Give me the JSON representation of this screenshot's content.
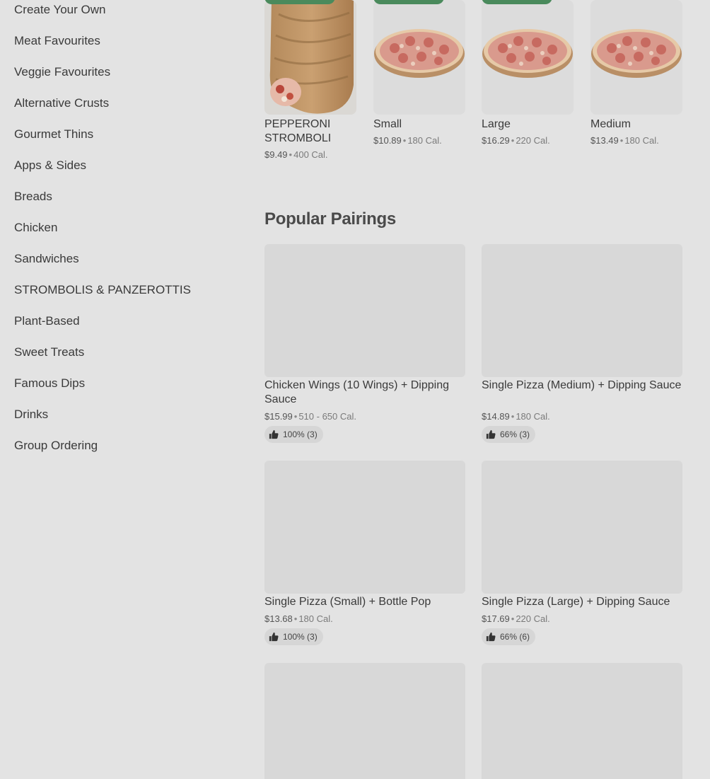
{
  "sidebar": {
    "items": [
      {
        "label": "Create Your Own"
      },
      {
        "label": "Meat Favourites"
      },
      {
        "label": "Veggie Favourites"
      },
      {
        "label": "Alternative Crusts"
      },
      {
        "label": "Gourmet Thins"
      },
      {
        "label": "Apps & Sides"
      },
      {
        "label": "Breads"
      },
      {
        "label": "Chicken"
      },
      {
        "label": "Sandwiches"
      },
      {
        "label": "STROMBOLIS & PANZEROTTIS"
      },
      {
        "label": "Plant-Based"
      },
      {
        "label": "Sweet Treats"
      },
      {
        "label": "Famous Dips"
      },
      {
        "label": "Drinks"
      },
      {
        "label": "Group Ordering"
      }
    ]
  },
  "featured": {
    "items": [
      {
        "name": "PEPPERONI STROMBOLI",
        "price": "$9.49",
        "calories": "400 Cal.",
        "image": "stromboli-image"
      },
      {
        "name": "Small",
        "price": "$10.89",
        "calories": "180 Cal.",
        "image": "pizza-image"
      },
      {
        "name": "Large",
        "price": "$16.29",
        "calories": "220 Cal.",
        "image": "pizza-image"
      },
      {
        "name": "Medium",
        "price": "$13.49",
        "calories": "180 Cal.",
        "image": "pizza-image"
      }
    ],
    "separator": "•"
  },
  "popular_pairings": {
    "title": "Popular Pairings",
    "items": [
      {
        "name": "Chicken Wings (10 Wings) + Dipping Sauce",
        "price": "$15.99",
        "calories": "510 - 650 Cal.",
        "rating": "100% (3)"
      },
      {
        "name": "Single Pizza (Medium) + Dipping Sauce",
        "price": "$14.89",
        "calories": "180 Cal.",
        "rating": "66% (3)"
      },
      {
        "name": "Single Pizza (Small) + Bottle Pop",
        "price": "$13.68",
        "calories": "180 Cal.",
        "rating": "100% (3)"
      },
      {
        "name": "Single Pizza (Large) + Dipping Sauce",
        "price": "$17.69",
        "calories": "220 Cal.",
        "rating": "66% (6)"
      }
    ]
  },
  "colors": {
    "background": "#e3e3e3",
    "badge": "#4a8a5c",
    "placeholder": "#d8d8d8"
  },
  "icons": {
    "rating": "thumbs-up-icon"
  }
}
